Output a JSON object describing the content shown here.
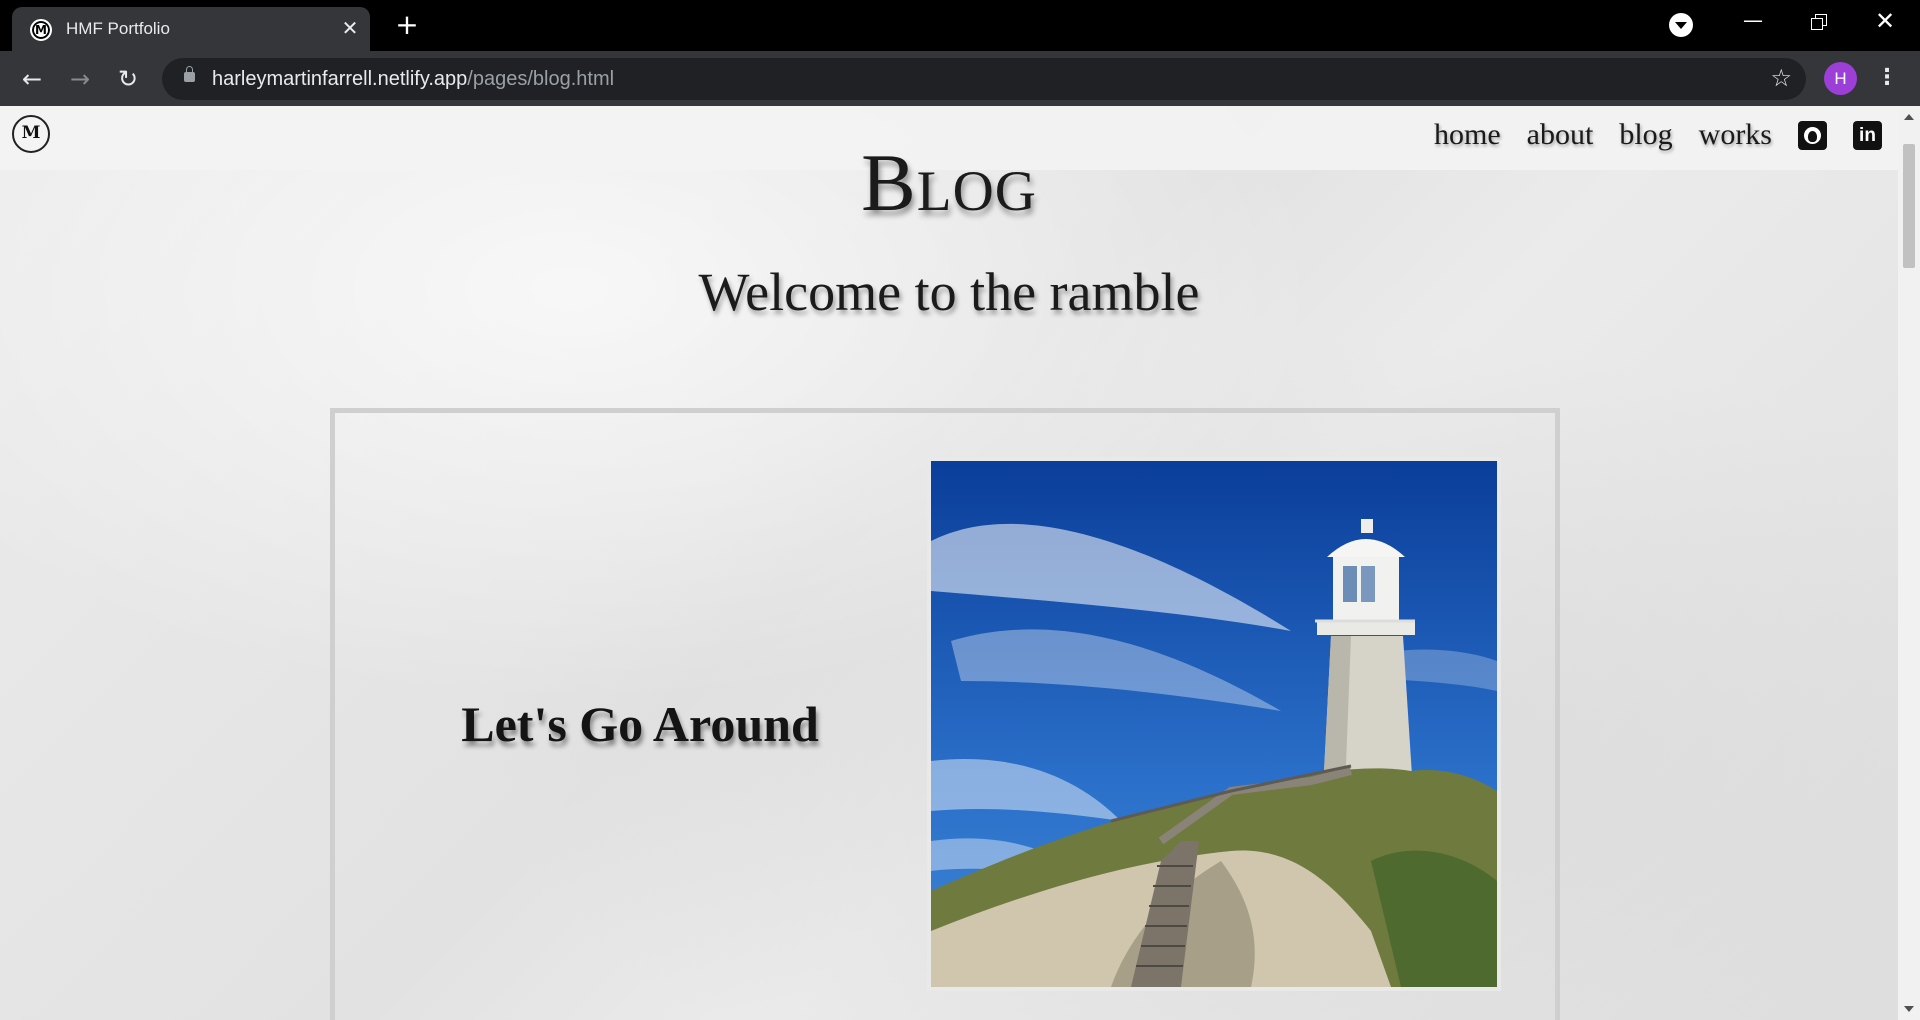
{
  "browser": {
    "tab_title": "HMF Portfolio",
    "favicon_text": "M",
    "url_host": "harleymartinfarrell.netlify.app",
    "url_path": "/pages/blog.html",
    "profile_initial": "H"
  },
  "site": {
    "logo_text": "M",
    "nav": [
      "home",
      "about",
      "blog",
      "works"
    ],
    "social": [
      "github-icon",
      "linkedin-icon"
    ],
    "linkedin_text": "in"
  },
  "page": {
    "title": "Blog",
    "subtitle": "Welcome to the ramble"
  },
  "posts": [
    {
      "title": "Let's Go Around"
    }
  ]
}
